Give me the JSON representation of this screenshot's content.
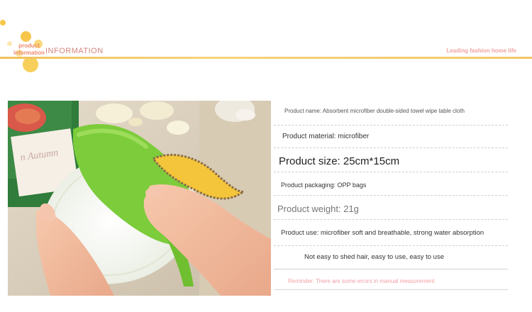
{
  "header": {
    "logo_line1": "product",
    "logo_line2": "information",
    "title": "INFORMATION",
    "tagline": "Leading fashion home life"
  },
  "product_image": {
    "subject": "hand wiping a white plate with a green microfiber towel",
    "plate_text": "n Autumn"
  },
  "specs": {
    "name": "Product name: Absorbent microfiber double-sided towel wipe table cloth",
    "material": "Product material: microfiber",
    "size": "Product size: 25cm*15cm",
    "packaging": "Product packaging: OPP bags",
    "weight": "Product weight: 21g",
    "use": "Product use: microfiber soft and breathable, strong water absorption",
    "feature": "Not easy to shed hair, easy to use, easy to use",
    "reminder": "Reminder: There are some errors in manual measurement"
  },
  "colors": {
    "accent_line": "#f3c766",
    "title_pink": "#d6857c",
    "reminder_pink": "#f2a0a6",
    "towel_green": "#7ccc3b",
    "towel_yellow": "#f4c53a"
  }
}
